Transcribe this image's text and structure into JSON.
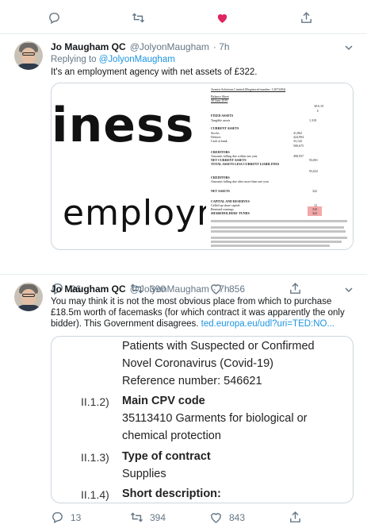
{
  "top_actions": {
    "reply_count": "",
    "retweet_count": "",
    "like_count": "",
    "colors": {
      "like": "#e0245e",
      "icon": "#657786"
    }
  },
  "tweet1": {
    "name": "Jo Maugham QC",
    "handle": "@JolyonMaugham",
    "time": "· 7h",
    "replying_label": "Replying to",
    "replying_handle": "@JolyonMaugham",
    "text": "It's an employment agency with net assets of £322.",
    "image_text_big": "iness (",
    "image_text_small": "employr",
    "doc_title": "Aventis Solutions Limited (Registered number: 12673284)",
    "doc_heading": "Balance Sheet",
    "doc_date": "30 June 2019",
    "doc_rows": [
      "FIXED ASSETS",
      "Tangible assets",
      "CURRENT ASSETS",
      "Stocks",
      "Debtors",
      "Cash at bank",
      "CREDITORS",
      "Amounts falling due within one year",
      "NET CURRENT ASSETS",
      "TOTAL ASSETS LESS CURRENT LIABILITIES",
      "CREDITORS",
      "Amounts falling due after more than one year",
      "NET ASSETS",
      "CAPITAL AND RESERVES",
      "Called up share capital",
      "Retained earnings",
      "SHAREHOLDERS' FUNDS"
    ],
    "doc_values": [
      "1,318",
      "41,862",
      "424,994",
      "33,142",
      "500,675",
      "490,937",
      "93,001",
      "93,022",
      "322",
      "12",
      "310",
      "322"
    ],
    "doc_year": "30.6.19",
    "doc_currency": "£",
    "reply_count": "26",
    "retweet_count": "390",
    "like_count": "856"
  },
  "tweet2": {
    "name": "Jo Maugham QC",
    "handle": "@JolyonMaugham",
    "time": "· 7h",
    "text": "You may think it is not the most obvious place from which to purchase £18.5m worth of facemasks (for which contract it was apparently the only bidder). This Government disagrees.",
    "link": "ted.europa.eu/udl?uri=TED:NO...",
    "card": {
      "line1": "Patients with Suspected or Confirmed",
      "line2": "Novel Coronavirus (Covid-19)",
      "line3": "Reference number: 546621",
      "s1_num": "II.1.2)",
      "s1_title": "Main CPV code",
      "s1_body1": "35113410 Garments for biological or",
      "s1_body2": "chemical protection",
      "s2_num": "II.1.3)",
      "s2_title": "Type of contract",
      "s2_body": "Supplies",
      "s3_num": "II.1.4)",
      "s3_title": "Short description:"
    },
    "reply_count": "13",
    "retweet_count": "394",
    "like_count": "843"
  }
}
